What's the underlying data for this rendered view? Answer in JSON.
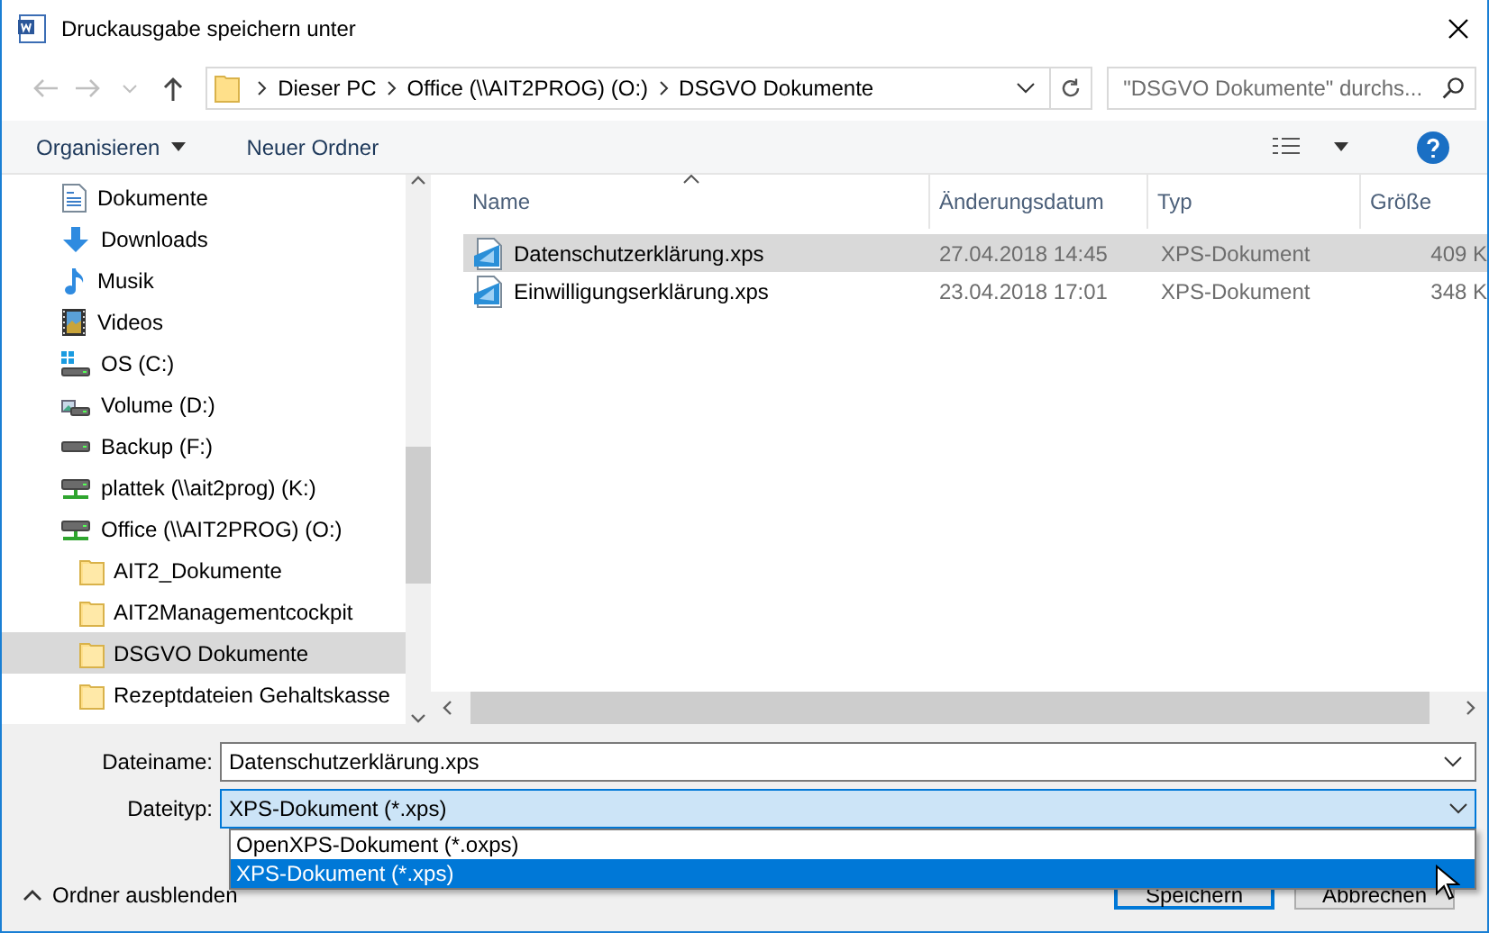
{
  "window": {
    "title": "Druckausgabe speichern unter"
  },
  "address_bar": {
    "breadcrumbs": [
      "Dieser PC",
      "Office (\\\\AIT2PROG) (O:)",
      "DSGVO Dokumente"
    ]
  },
  "search": {
    "placeholder": "\"DSGVO Dokumente\" durchs..."
  },
  "toolbar": {
    "items": [
      {
        "label": "Organisieren",
        "kind": "menu"
      },
      {
        "label": "Neuer Ordner",
        "kind": "button"
      }
    ]
  },
  "navigation": {
    "items": [
      {
        "label": "Dokumente",
        "kind": "documents",
        "selected": false
      },
      {
        "label": "Downloads",
        "kind": "downloads",
        "selected": false
      },
      {
        "label": "Musik",
        "kind": "music",
        "selected": false
      },
      {
        "label": "Videos",
        "kind": "videos",
        "selected": false
      },
      {
        "label": "OS (C:)",
        "kind": "system-drive",
        "selected": false
      },
      {
        "label": "Volume (D:)",
        "kind": "media-drive",
        "selected": false
      },
      {
        "label": "Backup (F:)",
        "kind": "drive",
        "selected": false
      },
      {
        "label": "plattek (\\\\ait2prog) (K:)",
        "kind": "network-drive",
        "selected": false
      },
      {
        "label": "Office (\\\\AIT2PROG) (O:)",
        "kind": "network-drive",
        "selected": false,
        "children": [
          {
            "label": "AIT2_Dokumente",
            "kind": "folder",
            "selected": false
          },
          {
            "label": "AIT2Managementcockpit",
            "kind": "folder",
            "selected": false
          },
          {
            "label": "DSGVO Dokumente",
            "kind": "folder",
            "selected": true
          },
          {
            "label": "Rezeptdateien Gehaltskasse",
            "kind": "folder",
            "selected": false
          }
        ]
      }
    ]
  },
  "file_list": {
    "columns": [
      "Name",
      "Änderungsdatum",
      "Typ",
      "Größe"
    ],
    "rows": [
      {
        "name": "Datenschutzerklärung.xps",
        "date": "27.04.2018 14:45",
        "type": "XPS-Dokument",
        "size": "409 K",
        "selected": true
      },
      {
        "name": "Einwilligungserklärung.xps",
        "date": "23.04.2018 17:01",
        "type": "XPS-Dokument",
        "size": "348 K",
        "selected": false
      }
    ]
  },
  "form": {
    "file_name": {
      "label": "Dateiname:",
      "value": "Datenschutzerklärung.xps"
    },
    "file_type": {
      "label": "Dateityp:",
      "value": "XPS-Dokument (*.xps)",
      "expanded": true,
      "options": [
        {
          "label": "OpenXPS-Dokument (*.oxps)",
          "selected": false
        },
        {
          "label": "XPS-Dokument (*.xps)",
          "selected": true
        }
      ]
    }
  },
  "hide_folders": "Ordner ausblenden",
  "buttons": [
    "Speichern",
    "Abbrechen"
  ]
}
